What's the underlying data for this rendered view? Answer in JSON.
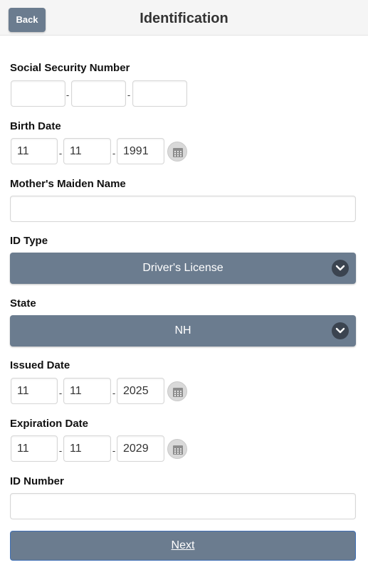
{
  "header": {
    "back_label": "Back",
    "title": "Identification"
  },
  "ssn": {
    "label": "Social Security Number",
    "part1": "",
    "part2": "",
    "part3": ""
  },
  "birth_date": {
    "label": "Birth Date",
    "month": "11",
    "day": "11",
    "year": "1991"
  },
  "maiden_name": {
    "label": "Mother's Maiden Name",
    "value": ""
  },
  "id_type": {
    "label": "ID Type",
    "selected": "Driver's License"
  },
  "state": {
    "label": "State",
    "selected": "NH"
  },
  "issued_date": {
    "label": "Issued Date",
    "month": "11",
    "day": "11",
    "year": "2025"
  },
  "expiration_date": {
    "label": "Expiration Date",
    "month": "11",
    "day": "11",
    "year": "2029"
  },
  "id_number": {
    "label": "ID Number",
    "value": ""
  },
  "separator": "-",
  "next_label": "Next",
  "colors": {
    "button": "#6b7c8f",
    "header_bg": "#f5f5f5",
    "chevron_bg": "#3b4450"
  },
  "icons": {
    "date_picker": "calendar-icon",
    "dropdown": "chevron-down-icon"
  }
}
